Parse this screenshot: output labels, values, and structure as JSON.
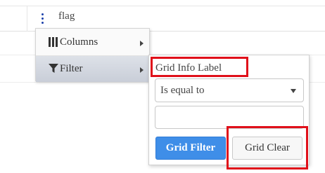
{
  "grid": {
    "column_title": "flag",
    "menu_icon": "kebab-vertical-icon",
    "menu_icon_color": "#1a3faa"
  },
  "column_menu": {
    "items": [
      {
        "label": "Columns",
        "icon": "columns-icon",
        "submenu_icon": "chevron-right-icon"
      },
      {
        "label": "Filter",
        "icon": "filter-funnel-icon",
        "submenu_icon": "chevron-right-icon"
      }
    ]
  },
  "filter_panel": {
    "info_label": "Grid Info Label",
    "operator": {
      "selected": "Is equal to"
    },
    "value": {
      "value": "",
      "placeholder": ""
    },
    "filter_button": "Grid Filter",
    "clear_button": "Grid Clear"
  },
  "colors": {
    "primary_button": "#3f8ee8",
    "highlight": "#e0101a",
    "active_menu_item": "#d3d7df"
  }
}
